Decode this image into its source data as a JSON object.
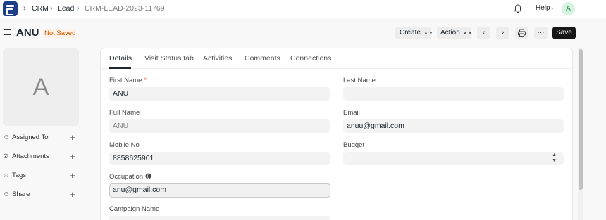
{
  "navbar": {
    "breadcrumbs": [
      "CRM",
      "Lead",
      "CRM-LEAD-2023-11769"
    ],
    "help_label": "Help",
    "user_initial": "A"
  },
  "header": {
    "title": "ANU",
    "status": "Not Saved",
    "create_label": "Create",
    "action_label": "Action",
    "save_label": "Save"
  },
  "sidebar": {
    "avatar_letter": "A",
    "items": [
      {
        "label": "Assigned To",
        "icon": "user-add-icon"
      },
      {
        "label": "Attachments",
        "icon": "paperclip-icon"
      },
      {
        "label": "Tags",
        "icon": "tag-icon"
      },
      {
        "label": "Share",
        "icon": "share-icon"
      }
    ]
  },
  "tabs": [
    "Details",
    "Visit Status tab",
    "Activities",
    "Comments",
    "Connections"
  ],
  "form": {
    "first_name": {
      "label": "First Name",
      "required_mark": "*",
      "value": "ANU"
    },
    "last_name": {
      "label": "Last Name",
      "value": ""
    },
    "full_name": {
      "label": "Full Name",
      "value": "ANU"
    },
    "email": {
      "label": "Email",
      "value": "anuu@gmail.com"
    },
    "mobile_no": {
      "label": "Mobile No",
      "value": "8858625901"
    },
    "budget": {
      "label": "Budget",
      "value": ""
    },
    "occupation": {
      "label": "Occupation",
      "value": "anu@gmail.com"
    },
    "campaign_name": {
      "label": "Campaign Name",
      "value": ""
    }
  },
  "colors": {
    "brand": "#1f3e8a",
    "save_button": "#171717",
    "not_saved": "#c95a00"
  }
}
